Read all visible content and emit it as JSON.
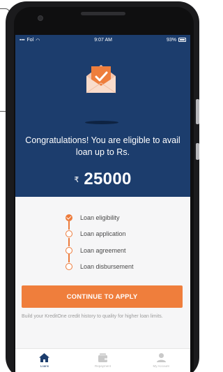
{
  "status_bar": {
    "carrier": "Fol",
    "time": "9:07 AM",
    "battery": "93%"
  },
  "hero": {
    "message": "Congratulations! You are eligible to avail loan up to Rs.",
    "currency_symbol": "₹",
    "amount": "25000"
  },
  "steps": [
    {
      "label": "Loan eligibility",
      "done": true
    },
    {
      "label": "Loan application",
      "done": false
    },
    {
      "label": "Loan agreement",
      "done": false
    },
    {
      "label": "Loan disbursement",
      "done": false
    }
  ],
  "cta": {
    "label": "CONTINUE TO APPLY"
  },
  "footnote": "Build your KreditOne credit history to quality for higher loan limits.",
  "bottom_nav": [
    {
      "label": "Loans",
      "icon": "home-icon",
      "active": true
    },
    {
      "label": "Repayment",
      "icon": "wallet-icon",
      "active": false
    },
    {
      "label": "My Account",
      "icon": "person-icon",
      "active": false
    }
  ],
  "colors": {
    "primary": "#1c3d6d",
    "accent": "#ed7b3b"
  }
}
